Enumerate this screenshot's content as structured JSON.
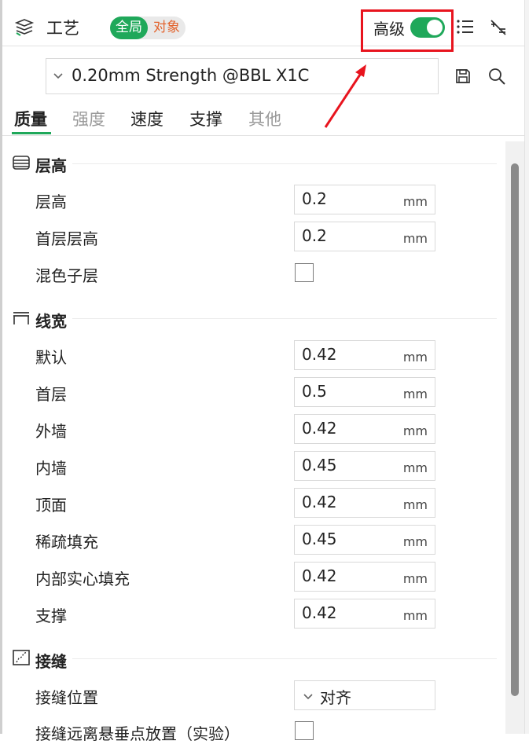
{
  "header": {
    "title": "工艺",
    "scope_global": "全局",
    "scope_object": "对象",
    "advanced_label": "高级",
    "advanced_on": true
  },
  "preset": {
    "value": "0.20mm Strength @BBL X1C"
  },
  "tabs": [
    {
      "label": "质量",
      "active": true
    },
    {
      "label": "强度",
      "active": false
    },
    {
      "label": "速度",
      "active": false
    },
    {
      "label": "支撑",
      "active": false
    },
    {
      "label": "其他",
      "active": false
    }
  ],
  "sections": {
    "layer_height": {
      "title": "层高",
      "rows": {
        "layer_height": {
          "label": "层高",
          "value": "0.2",
          "unit": "mm"
        },
        "first_layer_height": {
          "label": "首层层高",
          "value": "0.2",
          "unit": "mm"
        },
        "mixed_sublayer": {
          "label": "混色子层",
          "checked": false
        }
      }
    },
    "line_width": {
      "title": "线宽",
      "rows": [
        {
          "label": "默认",
          "value": "0.42",
          "unit": "mm"
        },
        {
          "label": "首层",
          "value": "0.5",
          "unit": "mm"
        },
        {
          "label": "外墙",
          "value": "0.42",
          "unit": "mm"
        },
        {
          "label": "内墙",
          "value": "0.45",
          "unit": "mm"
        },
        {
          "label": "顶面",
          "value": "0.42",
          "unit": "mm"
        },
        {
          "label": "稀疏填充",
          "value": "0.45",
          "unit": "mm"
        },
        {
          "label": "内部实心填充",
          "value": "0.42",
          "unit": "mm"
        },
        {
          "label": "支撑",
          "value": "0.42",
          "unit": "mm"
        }
      ]
    },
    "seam": {
      "title": "接缝",
      "rows": {
        "seam_position": {
          "label": "接缝位置",
          "value": "对齐"
        },
        "seam_away": {
          "label": "接缝远离悬垂点放置（实验）",
          "checked": false
        }
      }
    }
  },
  "colors": {
    "accent_green": "#1fa85a",
    "highlight_red": "#e8141e",
    "object_orange": "#e3632d"
  }
}
